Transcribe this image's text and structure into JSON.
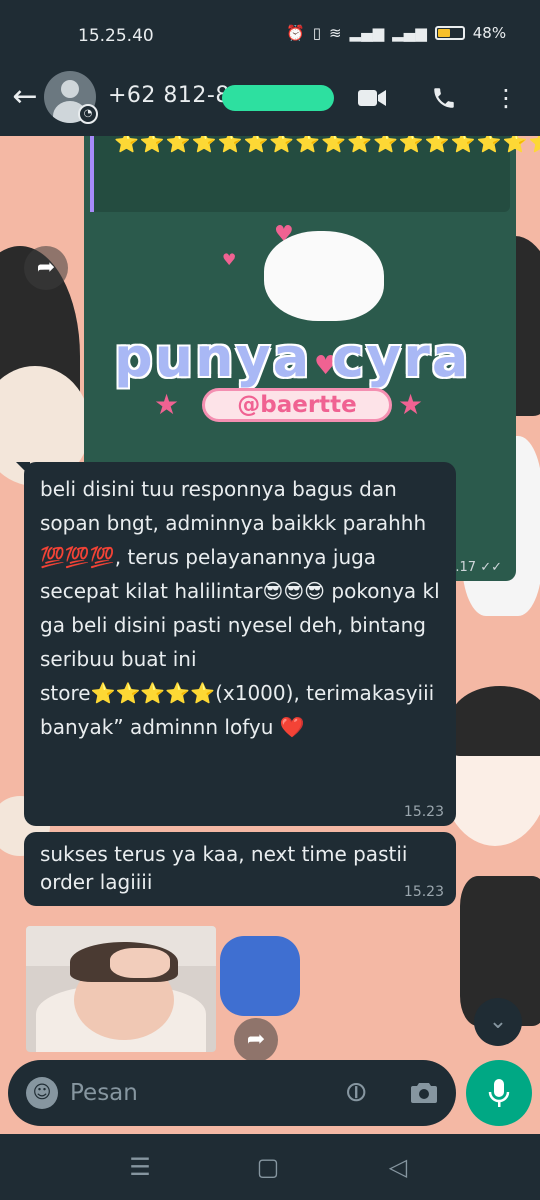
{
  "status_bar": {
    "time": "15.25.40",
    "battery": "48%",
    "battery_level": 0.48,
    "icons": [
      "alarm-icon",
      "vibrate-icon",
      "wifi-icon",
      "signal-icon",
      "signal-icon",
      "battery-icon"
    ]
  },
  "header": {
    "contact_name": "+62 812-8",
    "icons": [
      "back-arrow-icon",
      "video-call-icon",
      "phone-icon",
      "more-vert-icon"
    ]
  },
  "messages": {
    "image_message": {
      "stars": "⭐⭐⭐⭐⭐⭐⭐⭐⭐⭐⭐⭐⭐⭐⭐⭐⭐⭐⭐⭐⭐⭐⭐⭐⭐⭐⭐⭐⭐⭐⭐⭐⭐⭐⭐⭐",
      "sticker_title": "punya cyra",
      "sticker_handle": "@baertte",
      "time": "15.17 ✓✓"
    },
    "bubble_1": {
      "text": "beli disini tuu responnya bagus dan sopan bngt, adminnya baikkk parahhh 💯💯💯, terus pelayanannya juga secepat kilat halilintar😎😎😎 pokonya kl ga beli disini pasti nyesel deh, bintang seribuu buat ini store⭐⭐⭐⭐⭐(x1000), terimakasyiii banyak” adminnn lofyu ❤️",
      "time": "15.23"
    },
    "bubble_2": {
      "text": "sukses terus ya kaa, next time pastii order lagiiii",
      "time": "15.23"
    }
  },
  "input": {
    "placeholder": "Pesan"
  },
  "nav": {
    "recents": "☰",
    "home": "▢",
    "back": "◁"
  }
}
